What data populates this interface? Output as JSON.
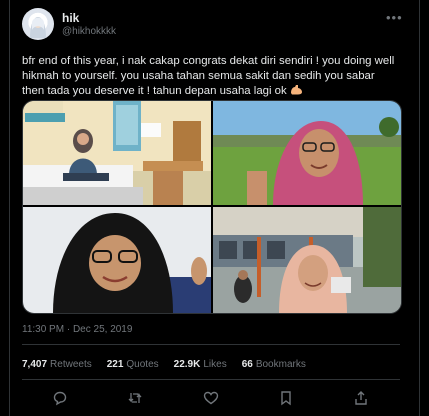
{
  "author": {
    "name": "hik",
    "handle": "@hikhokkkk"
  },
  "tweet": {
    "text": "bfr end of this year, i nak cakap congrats dekat diri sendiri ! you doing well hikmah to yourself. you usaha tahan semua sakit dan sedih you sabar then tada you deserve it ! tahun depan usaha lagi ok",
    "timestamp": "11:30 PM · Dec 25, 2019"
  },
  "stats": [
    {
      "value": "7,407",
      "label": "Retweets"
    },
    {
      "value": "221",
      "label": "Quotes"
    },
    {
      "value": "22.9K",
      "label": "Likes"
    },
    {
      "value": "66",
      "label": "Bookmarks"
    }
  ],
  "icons": {
    "more": "more-horizontal-icon",
    "muscle": "flexed-biceps-emoji",
    "reply": "reply-icon",
    "retweet": "retweet-icon",
    "like": "heart-icon",
    "bookmark": "bookmark-icon",
    "share": "share-icon"
  },
  "colors": {
    "background": "#000000",
    "text": "#e7e9ea",
    "secondary_text": "#71767b",
    "border": "#2f3336"
  }
}
